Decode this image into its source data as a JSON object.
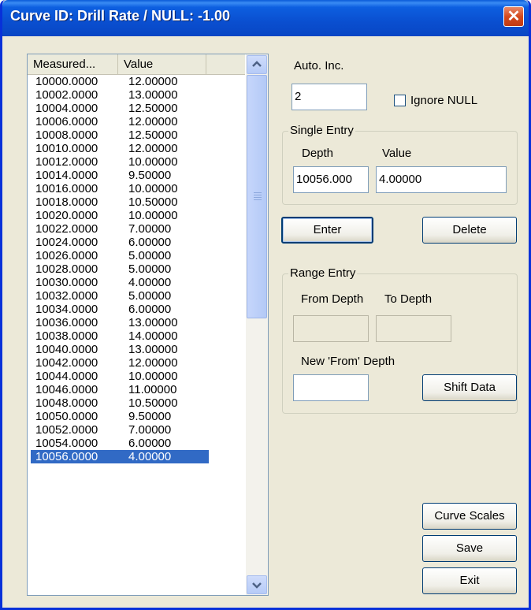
{
  "window": {
    "title": "Curve ID: Drill Rate / NULL: -1.00"
  },
  "list": {
    "headers": [
      "Measured...",
      "Value",
      ""
    ],
    "rows": [
      {
        "depth": "10000.0000",
        "value": "12.00000"
      },
      {
        "depth": "10002.0000",
        "value": "13.00000"
      },
      {
        "depth": "10004.0000",
        "value": "12.50000"
      },
      {
        "depth": "10006.0000",
        "value": "12.00000"
      },
      {
        "depth": "10008.0000",
        "value": "12.50000"
      },
      {
        "depth": "10010.0000",
        "value": "12.00000"
      },
      {
        "depth": "10012.0000",
        "value": "10.00000"
      },
      {
        "depth": "10014.0000",
        "value": "9.50000"
      },
      {
        "depth": "10016.0000",
        "value": "10.00000"
      },
      {
        "depth": "10018.0000",
        "value": "10.50000"
      },
      {
        "depth": "10020.0000",
        "value": "10.00000"
      },
      {
        "depth": "10022.0000",
        "value": "7.00000"
      },
      {
        "depth": "10024.0000",
        "value": "6.00000"
      },
      {
        "depth": "10026.0000",
        "value": "5.00000"
      },
      {
        "depth": "10028.0000",
        "value": "5.00000"
      },
      {
        "depth": "10030.0000",
        "value": "4.00000"
      },
      {
        "depth": "10032.0000",
        "value": "5.00000"
      },
      {
        "depth": "10034.0000",
        "value": "6.00000"
      },
      {
        "depth": "10036.0000",
        "value": "13.00000"
      },
      {
        "depth": "10038.0000",
        "value": "14.00000"
      },
      {
        "depth": "10040.0000",
        "value": "13.00000"
      },
      {
        "depth": "10042.0000",
        "value": "12.00000"
      },
      {
        "depth": "10044.0000",
        "value": "10.00000"
      },
      {
        "depth": "10046.0000",
        "value": "11.00000"
      },
      {
        "depth": "10048.0000",
        "value": "10.50000"
      },
      {
        "depth": "10050.0000",
        "value": "9.50000"
      },
      {
        "depth": "10052.0000",
        "value": "7.00000"
      },
      {
        "depth": "10054.0000",
        "value": "6.00000"
      },
      {
        "depth": "10056.0000",
        "value": "4.00000"
      }
    ],
    "selected_index": 28
  },
  "auto_inc": {
    "label": "Auto. Inc.",
    "value": "2"
  },
  "ignore_null": {
    "label": "Ignore NULL",
    "checked": false
  },
  "single_entry": {
    "title": "Single Entry",
    "depth_label": "Depth",
    "value_label": "Value",
    "depth_value": "10056.000",
    "value_value": "4.00000"
  },
  "buttons": {
    "enter": "Enter",
    "delete": "Delete",
    "shift_data": "Shift Data",
    "curve_scales": "Curve Scales",
    "save": "Save",
    "exit": "Exit"
  },
  "range_entry": {
    "title": "Range Entry",
    "from_label": "From Depth",
    "to_label": "To Depth",
    "new_from_label": "New 'From' Depth",
    "from_value": "",
    "to_value": "",
    "new_from_value": ""
  },
  "colors": {
    "title_bar": "#0a4fd0",
    "selection": "#316ac5",
    "dialog_bg": "#ece9d8"
  }
}
